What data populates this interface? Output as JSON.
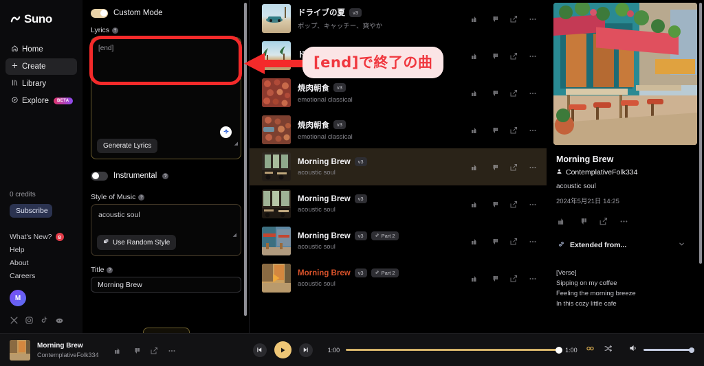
{
  "app": {
    "name": "Suno"
  },
  "sidebar": {
    "nav": [
      {
        "label": "Home",
        "icon": "home-icon",
        "active": false
      },
      {
        "label": "Create",
        "icon": "create-icon",
        "active": true
      },
      {
        "label": "Library",
        "icon": "library-icon",
        "active": false
      },
      {
        "label": "Explore",
        "icon": "explore-icon",
        "active": false,
        "badge": "BETA"
      }
    ],
    "credits": "0 credits",
    "subscribe_label": "Subscribe",
    "meta_links": [
      {
        "label": "What's New?",
        "count": "8"
      },
      {
        "label": "Help"
      },
      {
        "label": "About"
      },
      {
        "label": "Careers"
      }
    ],
    "avatar_initial": "M",
    "socials": [
      "x-icon",
      "instagram-icon",
      "tiktok-icon",
      "discord-icon"
    ]
  },
  "create": {
    "custom_mode_label": "Custom Mode",
    "custom_mode_on": true,
    "lyrics_label": "Lyrics",
    "lyrics_value": "[end]",
    "generate_lyrics_label": "Generate Lyrics",
    "instrumental_label": "Instrumental",
    "instrumental_on": false,
    "style_label": "Style of Music",
    "style_value": "acoustic soul",
    "random_style_label": "Use Random Style",
    "title_label": "Title",
    "title_value": "Morning Brew"
  },
  "songs": [
    {
      "title": "ドライブの夏",
      "version": "v3",
      "subtitle": "ポップ、キャッチー、爽やか",
      "thumb": "beach-car",
      "selected": false,
      "playing": false,
      "part": null
    },
    {
      "title": "ドライブの夏",
      "version": "v3",
      "subtitle": "",
      "thumb": "palm-beach",
      "selected": false,
      "playing": false,
      "part": null
    },
    {
      "title": "焼肉朝食",
      "version": "v3",
      "subtitle": "emotional classical",
      "thumb": "meat-food",
      "selected": false,
      "playing": false,
      "part": null
    },
    {
      "title": "焼肉朝食",
      "version": "v3",
      "subtitle": "emotional classical",
      "thumb": "meat-food2",
      "selected": false,
      "playing": false,
      "part": null
    },
    {
      "title": "Morning Brew",
      "version": "v3",
      "subtitle": "acoustic soul",
      "thumb": "cafe-interior",
      "selected": true,
      "playing": false,
      "part": null
    },
    {
      "title": "Morning Brew",
      "version": "v3",
      "subtitle": "acoustic soul",
      "thumb": "cafe-interior2",
      "selected": false,
      "playing": false,
      "part": null
    },
    {
      "title": "Morning Brew",
      "version": "v3",
      "subtitle": "acoustic soul",
      "thumb": "cafe-street",
      "selected": false,
      "playing": false,
      "part": "Part 2"
    },
    {
      "title": "Morning Brew",
      "version": "v3",
      "subtitle": "acoustic soul",
      "thumb": "cafe-street2",
      "selected": false,
      "playing": true,
      "part": "Part 2"
    }
  ],
  "row_action_icons": [
    "thumbs-up-icon",
    "thumbs-down-icon",
    "share-icon",
    "more-icon"
  ],
  "detail": {
    "title": "Morning Brew",
    "author": "ContemplativeFolk334",
    "style": "acoustic soul",
    "date": "2024年5月21日 14:25",
    "extended_from_label": "Extended from...",
    "lyrics": "[Verse]\nSipping on my coffee\nFeeling the morning breeze\nIn this cozy little cafe"
  },
  "player": {
    "title": "Morning Brew",
    "author": "ContemplativeFolk334",
    "current_time": "1:00",
    "total_time": "1:00",
    "progress_percent": 94,
    "volume_percent": 100,
    "is_playing": true,
    "icons": [
      "prev-icon",
      "play-icon",
      "next-icon",
      "loop-icon",
      "shuffle-icon",
      "volume-icon"
    ]
  },
  "annotations": {
    "bubble_text": "[end]で終了の曲",
    "highlight_color": "#f42a2a",
    "bubble_bg": "#fbe5e6",
    "bubble_fg": "#f0383f"
  }
}
